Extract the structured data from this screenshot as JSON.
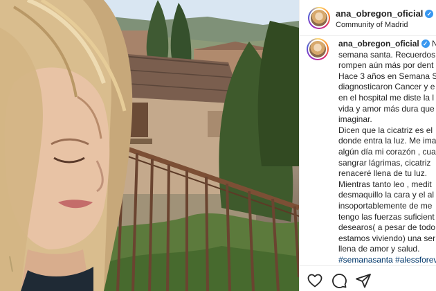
{
  "post": {
    "username": "ana_obregon_oficial",
    "location": "Community of Madrid"
  },
  "caption": {
    "username": "ana_obregon_oficial",
    "lines": [
      "No",
      "semana santa. Recuerdos",
      "rompen aún más por dent",
      "Hace 3 años en Semana S",
      "diagnosticaron Cancer y e",
      "en el hospital me diste la l",
      "vida y amor más dura que",
      "imaginar.",
      "Dicen que la cicatriz es el",
      "donde entra la luz. Me ima",
      "algún día mi corazón , cua",
      "sangrar lágrimas, cicatriz",
      "renaceré llena de tu luz.",
      "Mientras tanto leo , medit",
      "desmaquillo la cara y el al",
      "insoportablemente de me",
      "tengo las fuerzas suficient",
      "desearos( a pesar de todo",
      "estamos viviendo) una ser",
      "llena de amor y salud."
    ],
    "hashtags": "#semanasanta #alessforev"
  },
  "icons": {
    "verified": "verified-badge-icon",
    "like": "heart-icon",
    "comment": "comment-icon",
    "share": "share-icon"
  },
  "colors": {
    "verified": "#3897f0",
    "text": "#262626",
    "hashtag": "#00376b",
    "divider": "#efefef"
  }
}
